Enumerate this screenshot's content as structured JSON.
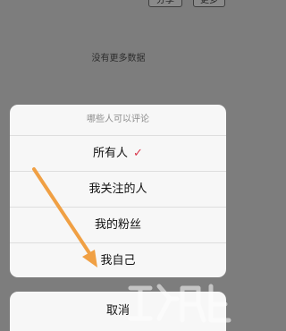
{
  "header": {
    "share_label": "分享",
    "more_label": "更多"
  },
  "feed": {
    "no_more_text": "没有更多数据"
  },
  "sheet": {
    "title": "哪些人可以评论",
    "options": [
      {
        "label": "所有人",
        "selected": true
      },
      {
        "label": "我关注的人",
        "selected": false
      },
      {
        "label": "我的粉丝",
        "selected": false
      },
      {
        "label": "我自己",
        "selected": false
      }
    ],
    "check_icon": "checkmark-icon",
    "check_color": "#d9364a"
  },
  "cancel_label": "取消",
  "annotation": {
    "arrow_color": "#f0a044"
  }
}
